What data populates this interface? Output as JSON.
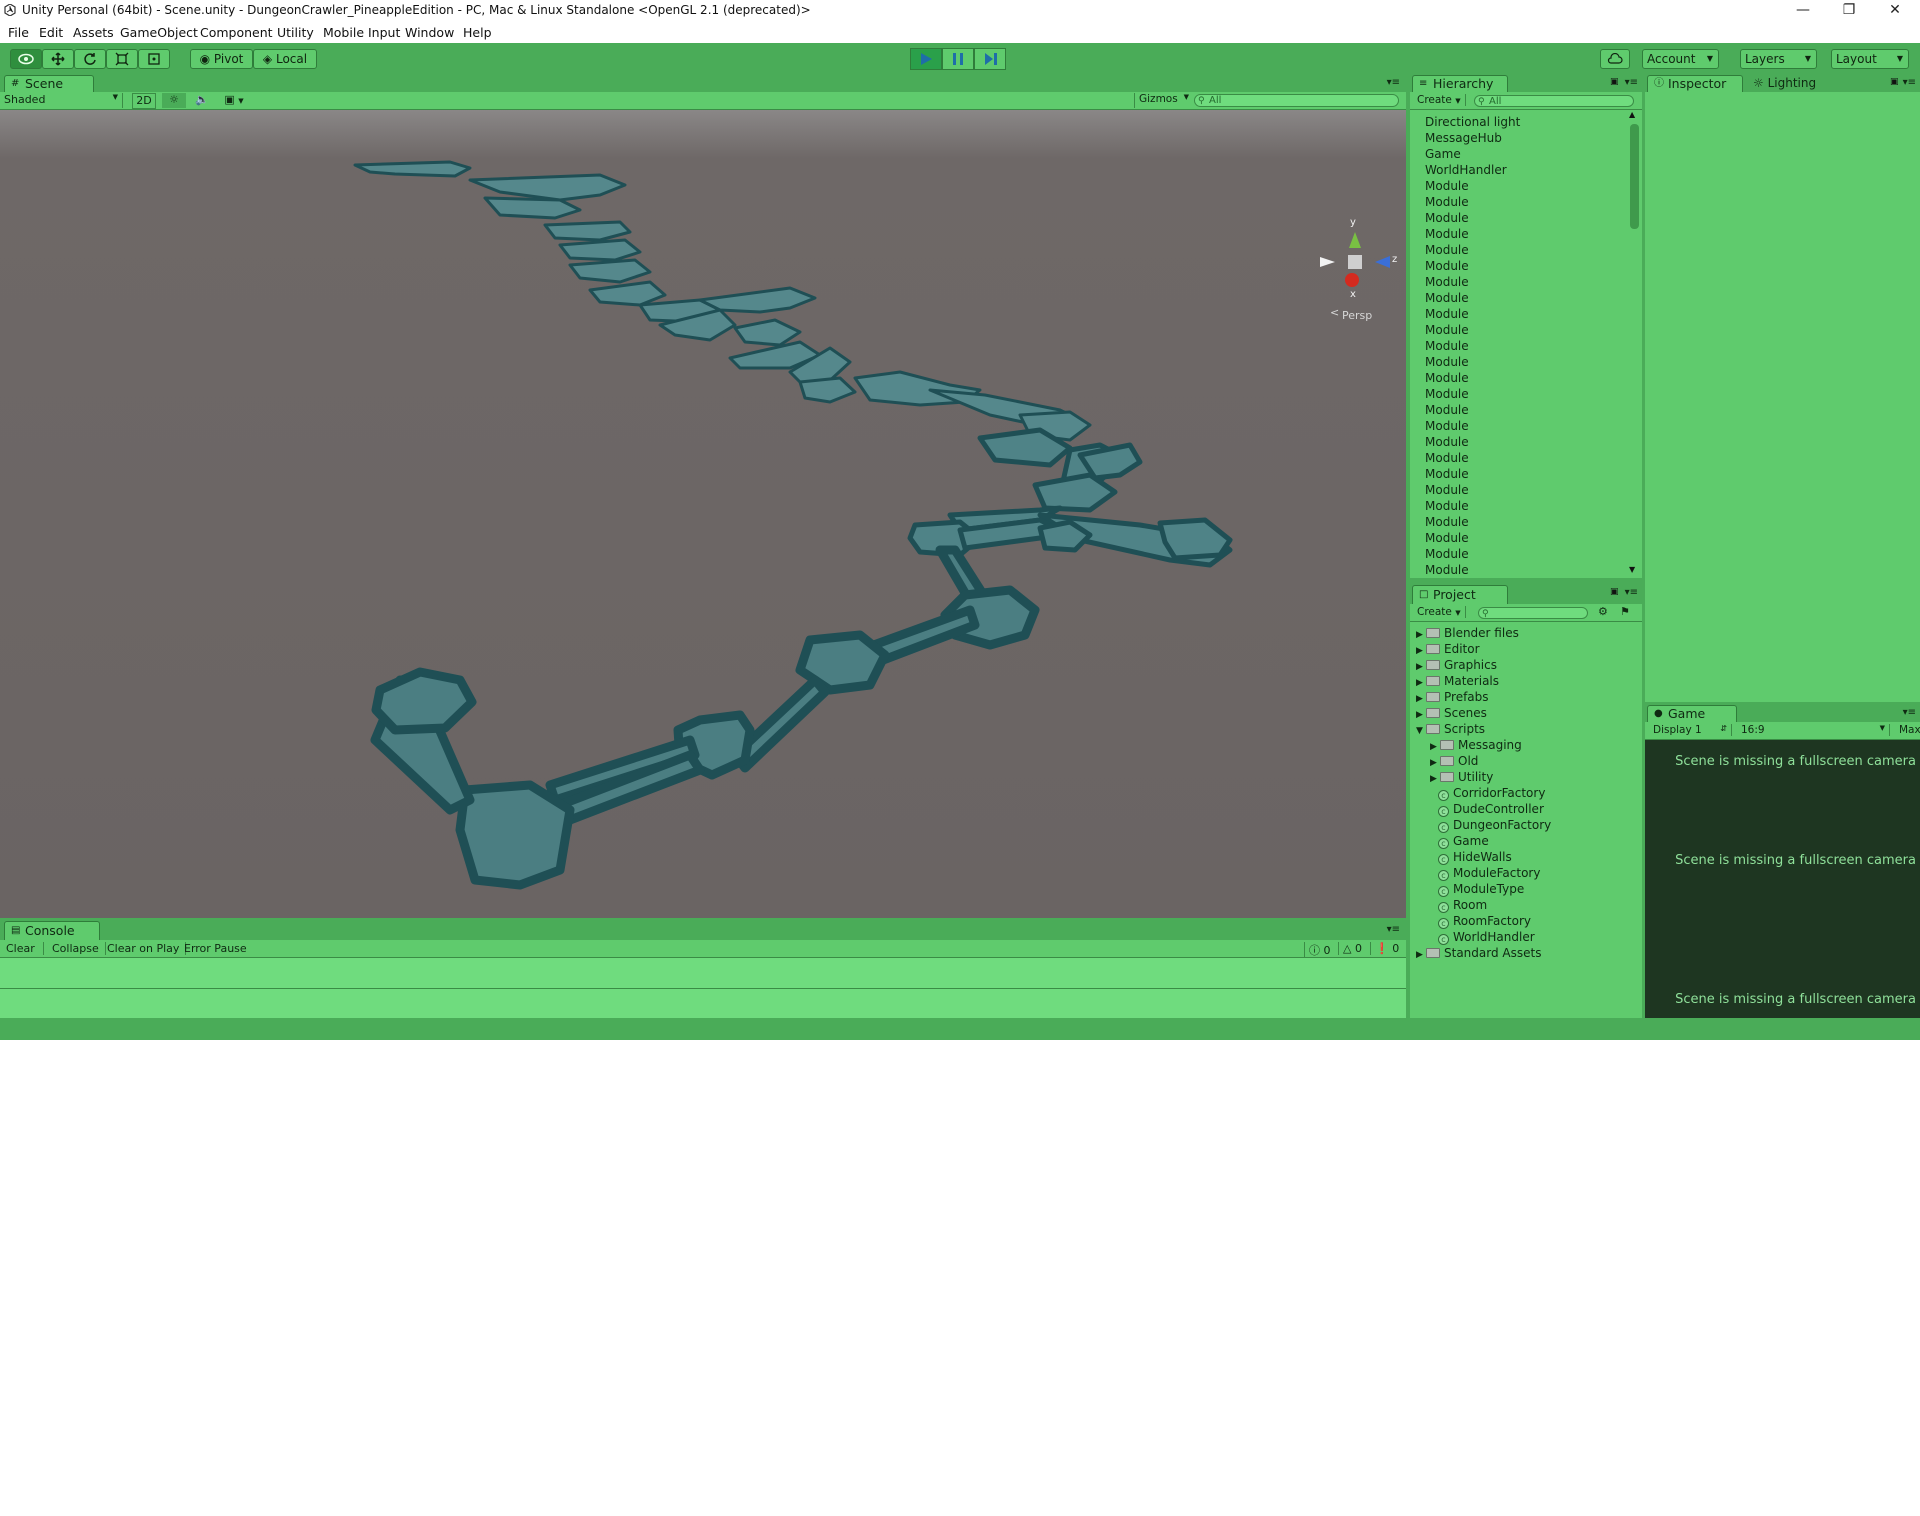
{
  "window": {
    "title": "Unity Personal (64bit) - Scene.unity - DungeonCrawler_PineappleEdition - PC, Mac & Linux Standalone <OpenGL 2.1 (deprecated)>",
    "minimize": "—",
    "maximize": "❐",
    "close": "✕"
  },
  "menu": [
    "File",
    "Edit",
    "Assets",
    "GameObject",
    "Component",
    "Utility",
    "Mobile Input",
    "Window",
    "Help"
  ],
  "toolbar": {
    "pivot_label": "Pivot",
    "local_label": "Local",
    "account_label": "Account",
    "layers_label": "Layers",
    "layout_label": "Layout"
  },
  "scene": {
    "tab_label": "Scene",
    "shading_mode": "Shaded",
    "mode_2d": "2D",
    "gizmos_label": "Gizmos",
    "search_placeholder": "All",
    "gizmo_y": "y",
    "gizmo_z": "z",
    "gizmo_x": "x",
    "projection_label": "Persp"
  },
  "hierarchy": {
    "tab_label": "Hierarchy",
    "create_label": "Create",
    "search_placeholder": "All",
    "items": [
      "Directional light",
      "MessageHub",
      "Game",
      "WorldHandler",
      "Module",
      "Module",
      "Module",
      "Module",
      "Module",
      "Module",
      "Module",
      "Module",
      "Module",
      "Module",
      "Module",
      "Module",
      "Module",
      "Module",
      "Module",
      "Module",
      "Module",
      "Module",
      "Module",
      "Module",
      "Module",
      "Module",
      "Module",
      "Module",
      "Module"
    ]
  },
  "inspector": {
    "tab_label": "Inspector",
    "lighting_label": "Lighting"
  },
  "project": {
    "tab_label": "Project",
    "create_label": "Create",
    "tree": [
      {
        "label": "Blender files",
        "type": "folder",
        "level": 0,
        "arrow": "▶"
      },
      {
        "label": "Editor",
        "type": "folder",
        "level": 0,
        "arrow": "▶"
      },
      {
        "label": "Graphics",
        "type": "folder",
        "level": 0,
        "arrow": "▶"
      },
      {
        "label": "Materials",
        "type": "folder",
        "level": 0,
        "arrow": "▶"
      },
      {
        "label": "Prefabs",
        "type": "folder",
        "level": 0,
        "arrow": "▶"
      },
      {
        "label": "Scenes",
        "type": "folder",
        "level": 0,
        "arrow": "▶"
      },
      {
        "label": "Scripts",
        "type": "folder",
        "level": 0,
        "arrow": "▼"
      },
      {
        "label": "Messaging",
        "type": "folder",
        "level": 1,
        "arrow": "▶"
      },
      {
        "label": "Old",
        "type": "folder",
        "level": 1,
        "arrow": "▶"
      },
      {
        "label": "Utility",
        "type": "folder",
        "level": 1,
        "arrow": "▶"
      },
      {
        "label": "CorridorFactory",
        "type": "script",
        "level": 1,
        "arrow": ""
      },
      {
        "label": "DudeController",
        "type": "script",
        "level": 1,
        "arrow": ""
      },
      {
        "label": "DungeonFactory",
        "type": "script",
        "level": 1,
        "arrow": ""
      },
      {
        "label": "Game",
        "type": "script",
        "level": 1,
        "arrow": ""
      },
      {
        "label": "HideWalls",
        "type": "script",
        "level": 1,
        "arrow": ""
      },
      {
        "label": "ModuleFactory",
        "type": "script",
        "level": 1,
        "arrow": ""
      },
      {
        "label": "ModuleType",
        "type": "script",
        "level": 1,
        "arrow": ""
      },
      {
        "label": "Room",
        "type": "script",
        "level": 1,
        "arrow": ""
      },
      {
        "label": "RoomFactory",
        "type": "script",
        "level": 1,
        "arrow": ""
      },
      {
        "label": "WorldHandler",
        "type": "script",
        "level": 1,
        "arrow": ""
      },
      {
        "label": "Standard Assets",
        "type": "folder",
        "level": 0,
        "arrow": "▶"
      }
    ]
  },
  "game": {
    "tab_label": "Game",
    "display_label": "Display 1",
    "aspect_label": "16:9",
    "maximize_label": "Max",
    "messages": [
      "Scene is missing a fullscreen camera",
      "Scene is missing a fullscreen camera",
      "Scene is missing a fullscreen camera"
    ]
  },
  "console": {
    "tab_label": "Console",
    "clear_label": "Clear",
    "collapse_label": "Collapse",
    "clear_on_play_label": "Clear on Play",
    "error_pause_label": "Error Pause",
    "info_count": "0",
    "warning_count": "0",
    "error_count": "0"
  },
  "colors": {
    "panel_green": "#5fcb6d",
    "toolbar_green": "#4aac58",
    "scene_background": "#6a6463",
    "dungeon_teal": "#4a7d80",
    "game_background": "#1e3621"
  },
  "icons": [
    "unity-logo-icon",
    "view-tool-icon",
    "move-tool-icon",
    "rotate-tool-icon",
    "scale-tool-icon",
    "rect-tool-icon",
    "play-icon",
    "pause-icon",
    "step-icon",
    "cloud-icon",
    "lock-icon",
    "menu-icon",
    "search-icon",
    "folder-icon",
    "script-icon"
  ]
}
